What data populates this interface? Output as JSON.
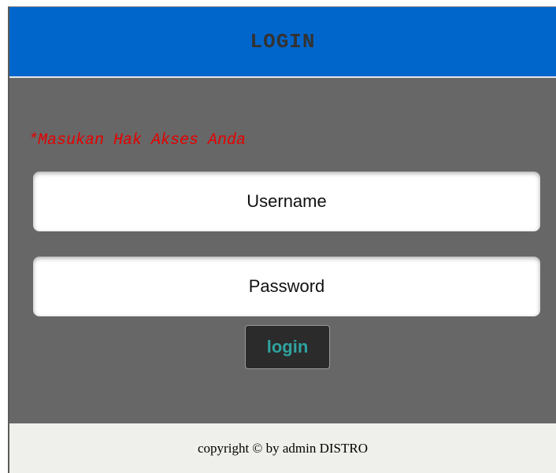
{
  "header": {
    "title": "LOGIN"
  },
  "form": {
    "notice": "*Masukan Hak Akses Anda",
    "username_placeholder": "Username",
    "password_placeholder": "Password",
    "submit_label": "login"
  },
  "footer": {
    "text": "copyright © by admin DISTRO"
  },
  "colors": {
    "header_bg": "#0066cc",
    "panel_bg": "#676767",
    "notice_text": "#e60000",
    "button_text": "#2fa3a0",
    "footer_bg": "#efefeb"
  }
}
